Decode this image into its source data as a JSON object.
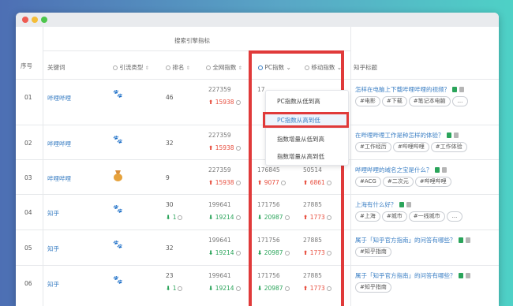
{
  "window": {
    "accent": "#3b7fc4",
    "highlight_color": "#e03a3a"
  },
  "table": {
    "group_header": "搜索引擎指标",
    "columns": {
      "seq": "序号",
      "keyword": "关键词",
      "source": "引流类型",
      "rank": "排名",
      "total_index": "全网指数",
      "pc_index": "PC指数",
      "mobile_index": "移动指数",
      "zhihu_title": "知乎标题"
    },
    "rows": [
      {
        "seq": "01",
        "keyword": "哔哩哔哩",
        "source_icon": "paw-icon",
        "rank": "46",
        "rank_change": "",
        "total": "227359",
        "total_change": "15938",
        "total_dir": "up",
        "pc": "17",
        "pc_change": "",
        "pc_dir": "up",
        "mobile": "",
        "mobile_change": "",
        "mobile_dir": "up",
        "title": "怎样在电脑上下载哔哩哔哩的视频？",
        "tags": [
          "#电影",
          "#下载",
          "#笔记本电脑",
          "..."
        ]
      },
      {
        "seq": "02",
        "keyword": "哔哩哔哩",
        "source_icon": "paw-icon",
        "rank": "32",
        "rank_change": "",
        "total": "227359",
        "total_change": "15938",
        "total_dir": "up",
        "pc": "",
        "pc_change": "",
        "pc_dir": "up",
        "mobile": "",
        "mobile_change": "",
        "mobile_dir": "up",
        "title": "在哔哩哔哩工作是种怎样的体验？",
        "tags": [
          "#工作经历",
          "#哔哩哔哩",
          "#工作体验"
        ]
      },
      {
        "seq": "03",
        "keyword": "哔哩哔哩",
        "source_icon": "medal-icon",
        "rank": "9",
        "rank_change": "",
        "total": "227359",
        "total_change": "15938",
        "total_dir": "up",
        "pc": "176845",
        "pc_change": "9077",
        "pc_dir": "up",
        "mobile": "50514",
        "mobile_change": "6861",
        "mobile_dir": "up",
        "title": "哔哩哔哩的域名之宝是什么？",
        "tags": [
          "#ACG",
          "#二次元",
          "#哔哩哔哩"
        ]
      },
      {
        "seq": "04",
        "keyword": "知乎",
        "source_icon": "paw-icon",
        "rank": "30",
        "rank_change": "1",
        "total": "199641",
        "total_change": "19214",
        "total_dir": "down",
        "pc": "171756",
        "pc_change": "20987",
        "pc_dir": "down",
        "mobile": "27885",
        "mobile_change": "1773",
        "mobile_dir": "up",
        "title": "上海有什么好？",
        "tags": [
          "#上海",
          "#城市",
          "#一线城市",
          "..."
        ]
      },
      {
        "seq": "05",
        "keyword": "知乎",
        "source_icon": "paw-icon",
        "rank": "32",
        "rank_change": "",
        "total": "199641",
        "total_change": "19214",
        "total_dir": "down",
        "pc": "171756",
        "pc_change": "20987",
        "pc_dir": "down",
        "mobile": "27885",
        "mobile_change": "1773",
        "mobile_dir": "up",
        "title": "属于「知乎官方指南」的问答有哪些？",
        "tags": [
          "#知乎指南"
        ]
      },
      {
        "seq": "06",
        "keyword": "知乎",
        "source_icon": "paw-icon",
        "rank": "23",
        "rank_change": "1",
        "total": "199641",
        "total_change": "19214",
        "total_dir": "down",
        "pc": "171756",
        "pc_change": "20987",
        "pc_dir": "down",
        "mobile": "27885",
        "mobile_change": "1773",
        "mobile_dir": "up",
        "title": "属于「知乎官方指南」的问答有哪些？",
        "tags": [
          "#知乎指南"
        ]
      }
    ]
  },
  "sort_menu": {
    "items": [
      "PC指数从低到高",
      "PC指数从高到低",
      "指数增量从低到高",
      "指数增量从高到低"
    ],
    "selected": "PC指数从高到低"
  }
}
